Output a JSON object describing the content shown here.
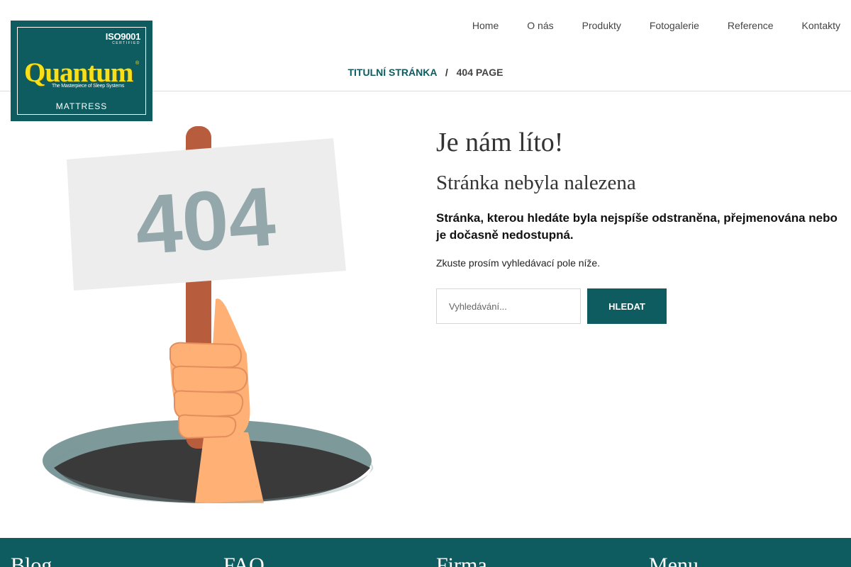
{
  "logo": {
    "iso": "ISO9001",
    "iso_sub": "CERTIFIED",
    "name": "Quantum",
    "reg": "®",
    "tagline": "The Masterpiece of Sleep Systems",
    "subtitle": "MATTRESS",
    "colors": {
      "background": "#0e5c5f",
      "name": "#f7e017"
    }
  },
  "nav": {
    "items": [
      {
        "label": "Home"
      },
      {
        "label": "O nás"
      },
      {
        "label": "Produkty"
      },
      {
        "label": "Fotogalerie"
      },
      {
        "label": "Reference"
      },
      {
        "label": "Kontakty"
      }
    ]
  },
  "breadcrumb": {
    "home": "Titulní stránka",
    "separator": "/",
    "current": "404 Page"
  },
  "illustration": {
    "sign_text": "404",
    "icon": "hand-holding-sign-icon"
  },
  "content": {
    "title": "Je nám líto!",
    "subtitle": "Stránka nebyla nalezena",
    "lead": "Stránka, kterou hledáte byla nejspíše odstraněna, přejmenována nebo je dočasně nedostupná.",
    "hint": "Zkuste prosím vyhledávací pole níže."
  },
  "search": {
    "placeholder": "Vyhledávání...",
    "value": "",
    "button": "Hledat"
  },
  "footer": {
    "columns": [
      {
        "title": "Blog"
      },
      {
        "title": "FAQ"
      },
      {
        "title": "Firma"
      },
      {
        "title": "Menu"
      }
    ]
  },
  "colors": {
    "accent": "#0e5c5f",
    "sign": "#ededed",
    "sign_text": "#94a7ab",
    "stick": "#b85c3e",
    "hand": "#ffb074",
    "hole_rim": "#7d999a",
    "hole": "#3a3a3a"
  }
}
